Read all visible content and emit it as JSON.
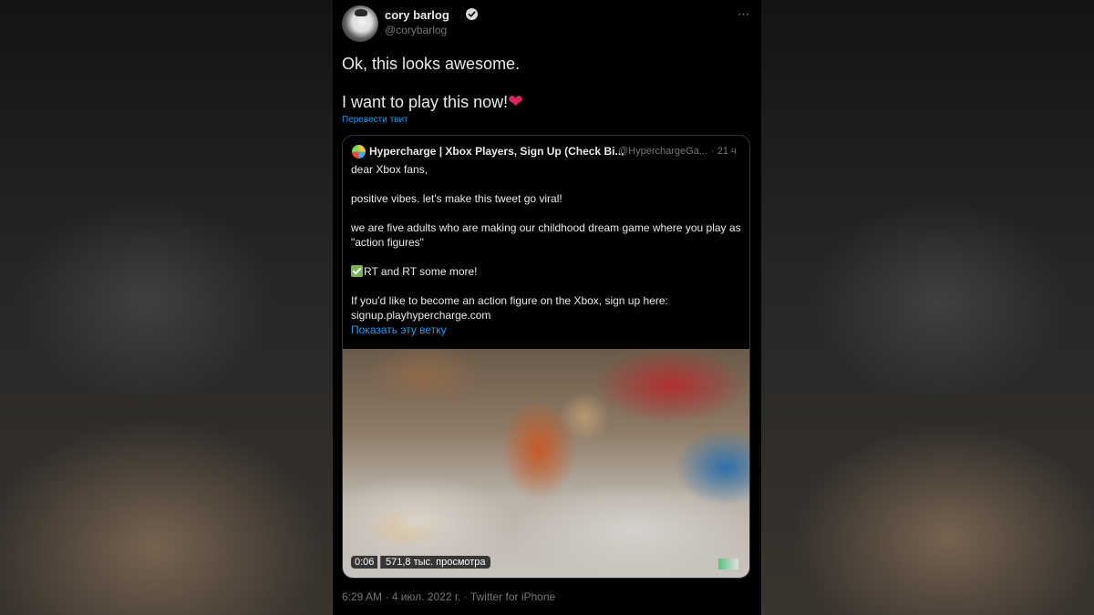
{
  "author": {
    "name": "cory barlog",
    "handle": "@corybarlog",
    "verified_icon": "verified-badge-icon",
    "avatar_icon": "profile-photo"
  },
  "more_icon": "more-dots-icon",
  "more_label": "···",
  "tweet": {
    "line1": "Ok, this looks awesome.",
    "line2": "I want to play this now!",
    "emoji": "❤",
    "translate_label": "Перевести твит"
  },
  "quoted": {
    "name": "Hypercharge | Xbox Players, Sign Up (Check Bi...",
    "handle": "@HyperchargeGa...",
    "time": "· 21 ч",
    "body": [
      "dear Xbox fans,",
      "positive vibes. let's make this tweet go viral!",
      "we are five adults who are making our childhood dream game where you play as \"action figures\"",
      "RT and RT some more!",
      "If you'd like to become an action figure on the Xbox, sign up here:",
      "signup.playhypercharge.com"
    ],
    "show_thread": "Показать эту ветку",
    "video": {
      "duration": "0:06",
      "views": "571,8 тыс. просмотра"
    }
  },
  "footer": {
    "time": "6:29 AM",
    "date": "4 июл. 2022 г.",
    "separator": "·",
    "source": "Twitter for iPhone"
  },
  "colors": {
    "background": "#000000",
    "text": "#e7e9ea",
    "muted": "#71767b",
    "link": "#1d9bf0",
    "heart": "#e0245e",
    "border": "#2f3336"
  }
}
